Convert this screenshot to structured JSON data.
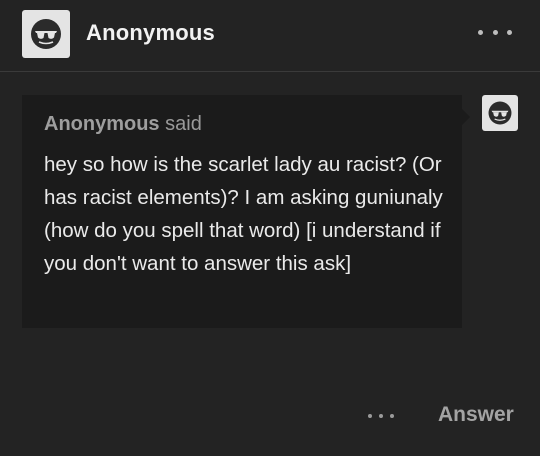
{
  "header": {
    "username": "Anonymous",
    "avatar_icon": "anonymous-sunglasses-icon",
    "more_icon": "more-dots-icon"
  },
  "ask": {
    "asker_name": "Anonymous",
    "said_label": "said",
    "question": "hey so how is the scarlet lady au racist? (Or has racist elements)? I am asking guniunaly (how do you spell that word) [i understand if you don't want to answer this ask]",
    "avatar_icon": "anonymous-sunglasses-icon"
  },
  "footer": {
    "more_icon": "more-dots-icon",
    "answer_label": "Answer"
  },
  "colors": {
    "background": "#232323",
    "bubble": "#1b1b1b",
    "text": "#eaeaea",
    "muted": "#9e9e9e"
  }
}
